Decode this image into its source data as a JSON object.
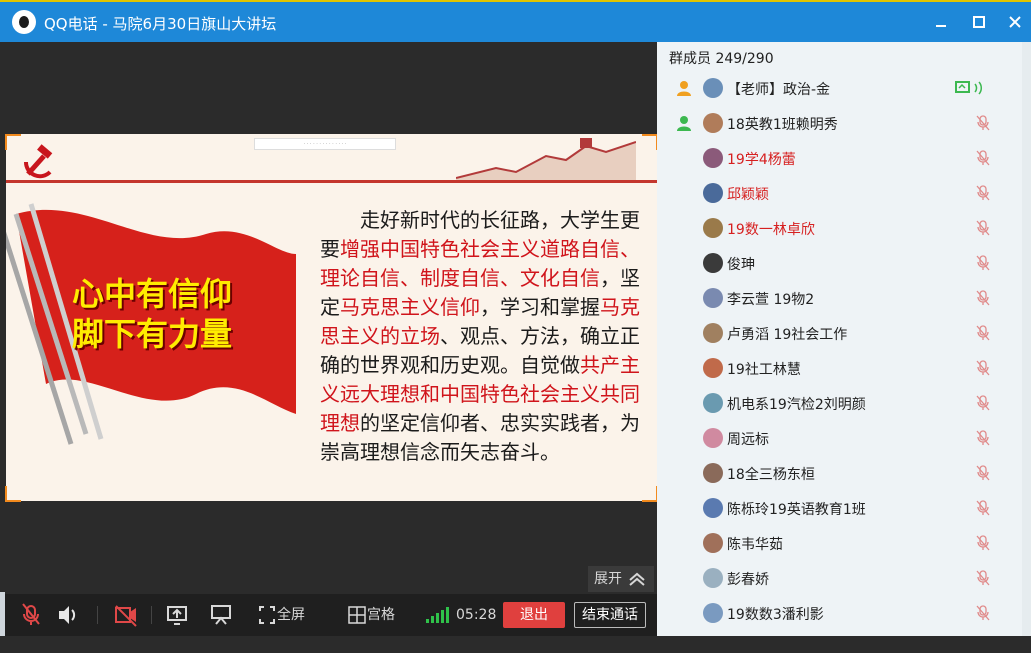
{
  "window": {
    "title": "QQ电话 - 马院6月30日旗山大讲坛",
    "minimize": "minimize",
    "maximize": "maximize",
    "close": "close"
  },
  "slide": {
    "slogan_line1": "心中有信仰",
    "slogan_line2": "脚下有力量",
    "paragraph": [
      {
        "t": "　　走好新时代的长征路，大学生更要",
        "red": false
      },
      {
        "t": "增强中国特色社会主义道路自信、理论自信、制度自信、文化自信",
        "red": true
      },
      {
        "t": "，坚定",
        "red": false
      },
      {
        "t": "马克思主义信仰",
        "red": true
      },
      {
        "t": "，学习和掌握",
        "red": false
      },
      {
        "t": "马克思主义的立场",
        "red": true
      },
      {
        "t": "、观点、方法，确立正确的世界观和历史观。自觉做",
        "red": false
      },
      {
        "t": "共产主义远大理想和中国特色社会主义共同理想",
        "red": true
      },
      {
        "t": "的坚定信仰者、忠实实践者，为崇高理想信念而矢志奋斗。",
        "red": false
      }
    ]
  },
  "video": {
    "expand_label": "展开",
    "fullscreen_label": "全屏",
    "grid_label": "宫格",
    "timer": "05:28",
    "exit_label": "退出",
    "end_call_label": "结束通话"
  },
  "sidebar": {
    "members_title": "群成员 249/290",
    "members": [
      {
        "name": "【老师】政治-金",
        "color": "#222222",
        "role": "admin",
        "sharing": true
      },
      {
        "name": "18英教1班赖明秀",
        "color": "#222222",
        "role": "admin",
        "sharing": false
      },
      {
        "name": "19学4杨蕾",
        "color": "#d62020",
        "role": "",
        "sharing": false
      },
      {
        "name": "邱颖颖",
        "color": "#d62020",
        "role": "",
        "sharing": false
      },
      {
        "name": "19数一林卓欣",
        "color": "#d62020",
        "role": "",
        "sharing": false
      },
      {
        "name": "俊珅",
        "color": "#222222",
        "role": "",
        "sharing": false
      },
      {
        "name": "李云萱 19物2",
        "color": "#222222",
        "role": "",
        "sharing": false
      },
      {
        "name": "卢勇滔 19社会工作",
        "color": "#222222",
        "role": "",
        "sharing": false
      },
      {
        "name": "19社工林慧",
        "color": "#222222",
        "role": "",
        "sharing": false
      },
      {
        "name": "机电系19汽检2刘明颜",
        "color": "#222222",
        "role": "",
        "sharing": false
      },
      {
        "name": "周远标",
        "color": "#222222",
        "role": "",
        "sharing": false
      },
      {
        "name": "18全三杨东桓",
        "color": "#222222",
        "role": "",
        "sharing": false
      },
      {
        "name": "陈栎玲19英语教育1班",
        "color": "#222222",
        "role": "",
        "sharing": false
      },
      {
        "name": "陈韦华茹",
        "color": "#222222",
        "role": "",
        "sharing": false
      },
      {
        "name": "彭春娇",
        "color": "#222222",
        "role": "",
        "sharing": false
      },
      {
        "name": "19数数3潘利影",
        "color": "#222222",
        "role": "",
        "sharing": false
      }
    ]
  }
}
